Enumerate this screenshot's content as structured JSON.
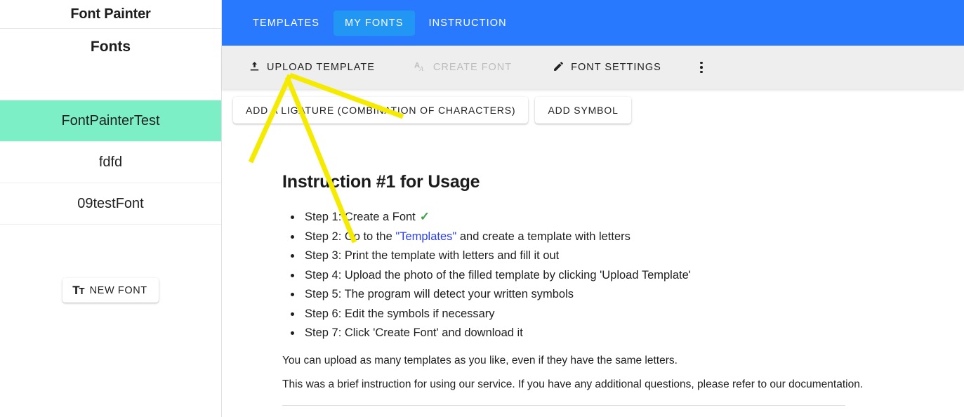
{
  "sidebar": {
    "app_title": "Font Painter",
    "section_header": "Fonts",
    "fonts": [
      {
        "name": "FontPainterTest",
        "selected": true
      },
      {
        "name": "fdfd",
        "selected": false
      },
      {
        "name": "09testFont",
        "selected": false
      }
    ],
    "new_font_button": {
      "label": "NEW FONT",
      "icon": "text-format-icon",
      "icon_glyph_main": "T",
      "icon_glyph_sub": "T"
    }
  },
  "topbar": {
    "accent_color": "#2979ff",
    "active_tab_color": "#2196f3",
    "tabs": [
      {
        "label": "TEMPLATES",
        "active": false
      },
      {
        "label": "MY FONTS",
        "active": true
      },
      {
        "label": "INSTRUCTION",
        "active": false
      }
    ]
  },
  "toolbar": {
    "background": "#eeeeee",
    "buttons": [
      {
        "label": "UPLOAD TEMPLATE",
        "icon": "upload-icon",
        "disabled": false
      },
      {
        "label": "CREATE FONT",
        "icon": "font-download-icon",
        "disabled": true
      },
      {
        "label": "FONT SETTINGS",
        "icon": "pencil-icon",
        "disabled": false
      }
    ],
    "overflow_menu": "more-vertical-icon"
  },
  "subbar": {
    "buttons": [
      {
        "label": "ADD A LIGATURE (COMBINATION OF CHARACTERS)"
      },
      {
        "label": "ADD SYMBOL"
      }
    ]
  },
  "content": {
    "heading": "Instruction #1 for Usage",
    "steps": [
      {
        "text": "Step 1: Create a Font",
        "check": "✓",
        "has_check": true
      },
      {
        "pre": "Step 2: Go to the ",
        "link": "\"Templates\"",
        "post": " and create a template with letters"
      },
      {
        "text": "Step 3: Print the template with letters and fill it out"
      },
      {
        "text": "Step 4: Upload the photo of the filled template by clicking 'Upload Template'"
      },
      {
        "text": "Step 5: The program will detect your written symbols"
      },
      {
        "text": "Step 6: Edit the symbols if necessary"
      },
      {
        "text": "Step 7: Click 'Create Font' and download it"
      }
    ],
    "paragraph_1": "You can upload as many templates as you like, even if they have the same letters.",
    "paragraph_2": "This was a brief instruction for using our service. If you have any additional questions, please refer to our documentation."
  },
  "annotation": {
    "type": "arrow-highlight",
    "color": "#f5eb00",
    "target_label": "UPLOAD TEMPLATE"
  }
}
